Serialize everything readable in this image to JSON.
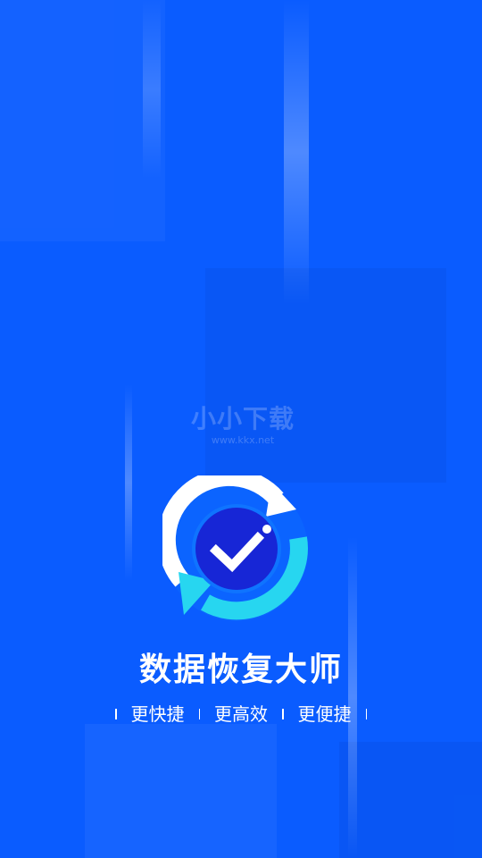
{
  "brand": {
    "background_color": "#0a5cff",
    "accent_color": "#27d6f0",
    "logo_icon": "recover-check-icon"
  },
  "app": {
    "title": "数据恢复大师"
  },
  "slogans": [
    "更快捷",
    "更高效",
    "更便捷"
  ],
  "watermark": {
    "title": "小小下载",
    "url": "www.kkx.net"
  }
}
